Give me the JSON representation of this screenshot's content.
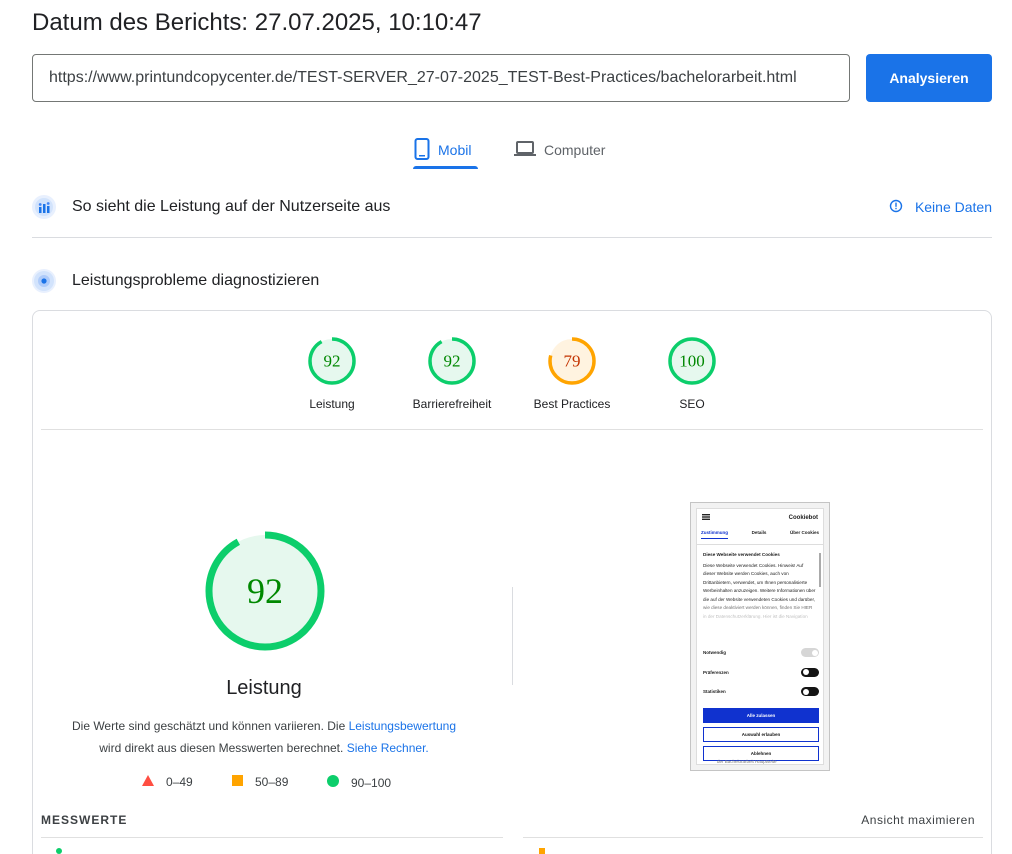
{
  "header": {
    "report_date": "Datum des Berichts: 27.07.2025, 10:10:47"
  },
  "search": {
    "url_value": "https://www.printundcopycenter.de/TEST-SERVER_27-07-2025_TEST-Best-Practices/bachelorarbeit.html",
    "analyze_label": "Analysieren"
  },
  "tabs": {
    "mobile_label": "Mobil",
    "desktop_label": "Computer",
    "active": "mobile"
  },
  "field_data": {
    "title": "So sieht die Leistung auf der Nutzerseite aus",
    "no_data_label": "Keine Daten"
  },
  "lab_data": {
    "title": "Leistungsprobleme diagnostizieren"
  },
  "scores": [
    {
      "label": "Leistung",
      "value": "92",
      "status": "pass"
    },
    {
      "label": "Barrierefreiheit",
      "value": "92",
      "status": "pass"
    },
    {
      "label": "Best Practices",
      "value": "79",
      "status": "average"
    },
    {
      "label": "SEO",
      "value": "100",
      "status": "pass"
    }
  ],
  "performance": {
    "score": "92",
    "score_fraction": 0.92,
    "title": "Leistung",
    "desc_part1": "Die Werte sind geschätzt und können variieren. Die ",
    "desc_link1": "Leistungsbewertung",
    "desc_part2": "wird direkt aus diesen Messwerten berechnet. ",
    "desc_link2": "Siehe Rechner."
  },
  "legend": {
    "fail": "0–49",
    "average": "50–89",
    "pass": "90–100"
  },
  "metrics": {
    "heading": "MESSWERTE",
    "maximize_label": "Ansicht maximieren"
  },
  "colors": {
    "pass": "#0cce6b",
    "pass_bg": "#e6f8ee",
    "pass_text": "#008800",
    "average": "#ffa400",
    "average_bg": "#fff3e0",
    "average_text": "#c33300",
    "fail": "#ff4e42",
    "accent": "#1a73e8"
  },
  "phone_preview": {
    "brand": "Cookiebot",
    "tabs": [
      "Zustimmung",
      "Details",
      "Über Cookies"
    ],
    "heading": "Diese Webseite verwendet Cookies",
    "body": "Diese Webseite verwendet Cookies. Hinweis! Auf dieser Website werden Cookies, auch von Drittanbietern, verwendet, um Ihnen personalisierte Werbeinhalten anzuzeigen. Weitere Informationen über die auf der Website verwendeten Cookies und darüber, wie diese deaktiviert werden können, finden Sie HIER in der Datenschutzerklärung. Hier ist die Navigation",
    "toggles": [
      {
        "label": "Notwendig",
        "on": false
      },
      {
        "label": "Präferenzen",
        "on": true
      },
      {
        "label": "Statistiken",
        "on": true
      }
    ],
    "btn_allow_all": "Alle zulassen",
    "btn_allow_selection": "Auswahl erlauben",
    "btn_reject": "Ablehnen",
    "footer": "der Bachelorarbeit Hauptseite"
  }
}
